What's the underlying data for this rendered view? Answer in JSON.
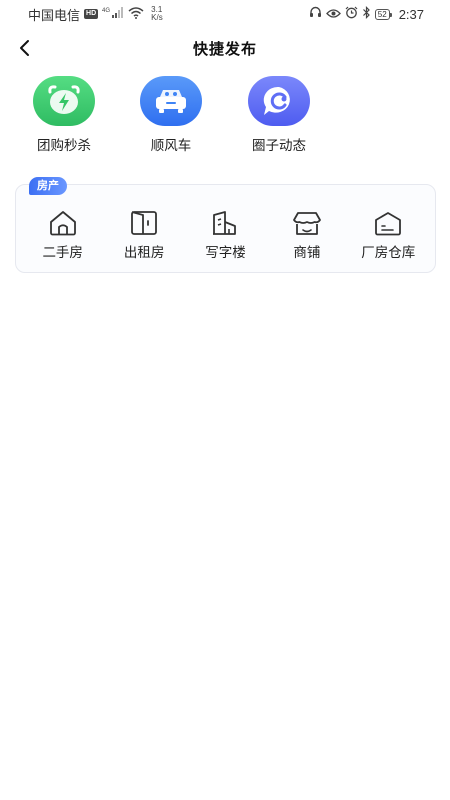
{
  "status_bar": {
    "carrier": "中国电信",
    "hd": "HD",
    "network": "4G",
    "speed_value": "3.1",
    "speed_unit": "K/s",
    "battery": "52",
    "time": "2:37"
  },
  "header": {
    "title": "快捷发布"
  },
  "quick_items": [
    {
      "label": "团购秒杀",
      "icon": "alarm-clock-icon",
      "color": "#3ec96e"
    },
    {
      "label": "顺风车",
      "icon": "car-icon",
      "color": "#3f84f5"
    },
    {
      "label": "圈子动态",
      "icon": "chat-bubble-icon",
      "color": "#5f6ef5"
    }
  ],
  "property_section": {
    "tag": "房产",
    "items": [
      {
        "label": "二手房",
        "icon": "house-icon"
      },
      {
        "label": "出租房",
        "icon": "door-icon"
      },
      {
        "label": "写字楼",
        "icon": "office-building-icon"
      },
      {
        "label": "商铺",
        "icon": "storefront-icon"
      },
      {
        "label": "厂房仓库",
        "icon": "warehouse-icon"
      }
    ]
  }
}
